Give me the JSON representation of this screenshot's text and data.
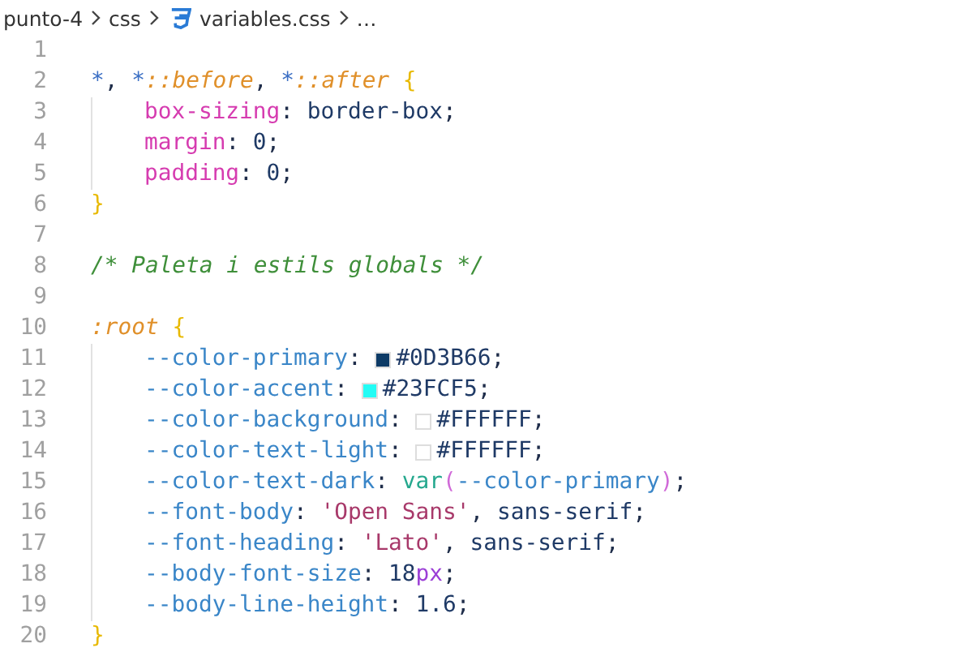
{
  "breadcrumb": [
    {
      "kind": "folder",
      "label": "punto-4"
    },
    {
      "kind": "folder",
      "label": "css"
    },
    {
      "kind": "file",
      "label": "variables.css"
    },
    {
      "kind": "more",
      "label": "…"
    }
  ],
  "editor": {
    "lines": [
      {
        "number": "1",
        "indented": false
      },
      {
        "number": "2",
        "indented": false,
        "tokens": [
          {
            "kind": "selector",
            "text": "*"
          },
          {
            "kind": "punct",
            "text": ", "
          },
          {
            "kind": "selector",
            "text": "*"
          },
          {
            "kind": "pseudo",
            "text": "::before"
          },
          {
            "kind": "punct",
            "text": ", "
          },
          {
            "kind": "selector",
            "text": "*"
          },
          {
            "kind": "pseudo",
            "text": "::after"
          },
          {
            "kind": "brace",
            "text": "{"
          }
        ]
      },
      {
        "number": "3",
        "indented": true,
        "tokens": [
          {
            "kind": "property",
            "text": "box-sizing"
          },
          {
            "kind": "punct",
            "text": ": "
          },
          {
            "kind": "value",
            "text": "border-box"
          },
          {
            "kind": "punct",
            "text": ";"
          }
        ]
      },
      {
        "number": "4",
        "indented": true,
        "tokens": [
          {
            "kind": "property",
            "text": "margin"
          },
          {
            "kind": "punct",
            "text": ": "
          },
          {
            "kind": "number",
            "text": "0"
          },
          {
            "kind": "punct",
            "text": ";"
          }
        ]
      },
      {
        "number": "5",
        "indented": true,
        "tokens": [
          {
            "kind": "property",
            "text": "padding"
          },
          {
            "kind": "punct",
            "text": ": "
          },
          {
            "kind": "number",
            "text": "0"
          },
          {
            "kind": "punct",
            "text": ";"
          }
        ]
      },
      {
        "number": "6",
        "indented": false,
        "tokens": [
          {
            "kind": "brace",
            "text": "}"
          }
        ]
      },
      {
        "number": "7",
        "indented": false
      },
      {
        "number": "8",
        "indented": false,
        "tokens": [
          {
            "kind": "comment",
            "text": "/* Paleta i estils globals */"
          }
        ]
      },
      {
        "number": "9",
        "indented": false
      },
      {
        "number": "10",
        "indented": false,
        "tokens": [
          {
            "kind": "pseudo",
            "text": ":root"
          },
          {
            "kind": "brace",
            "text": "{"
          }
        ]
      },
      {
        "number": "11",
        "indented": true,
        "tokens": [
          {
            "kind": "variable",
            "text": "--color-primary"
          },
          {
            "kind": "punct",
            "text": ": "
          },
          {
            "kind": "swatch",
            "color": "#0d3b66"
          },
          {
            "kind": "value",
            "text": "#0D3B66"
          },
          {
            "kind": "punct",
            "text": ";"
          }
        ]
      },
      {
        "number": "12",
        "indented": true,
        "tokens": [
          {
            "kind": "variable",
            "text": "--color-accent"
          },
          {
            "kind": "punct",
            "text": ": "
          },
          {
            "kind": "swatch",
            "color": "#23fcf5"
          },
          {
            "kind": "value",
            "text": "#23FCF5"
          },
          {
            "kind": "punct",
            "text": ";"
          }
        ]
      },
      {
        "number": "13",
        "indented": true,
        "tokens": [
          {
            "kind": "variable",
            "text": "--color-background"
          },
          {
            "kind": "punct",
            "text": ": "
          },
          {
            "kind": "swatch",
            "color": "#ffffff"
          },
          {
            "kind": "value",
            "text": "#FFFFFF"
          },
          {
            "kind": "punct",
            "text": ";"
          }
        ]
      },
      {
        "number": "14",
        "indented": true,
        "tokens": [
          {
            "kind": "variable",
            "text": "--color-text-light"
          },
          {
            "kind": "punct",
            "text": ": "
          },
          {
            "kind": "swatch",
            "color": "#ffffff"
          },
          {
            "kind": "value",
            "text": "#FFFFFF"
          },
          {
            "kind": "punct",
            "text": ";"
          }
        ]
      },
      {
        "number": "15",
        "indented": true,
        "tokens": [
          {
            "kind": "variable",
            "text": "--color-text-dark"
          },
          {
            "kind": "punct",
            "text": ": "
          },
          {
            "kind": "function",
            "text": "var"
          },
          {
            "kind": "paren",
            "text": "("
          },
          {
            "kind": "variable",
            "text": "--color-primary"
          },
          {
            "kind": "paren",
            "text": ")"
          },
          {
            "kind": "punct",
            "text": ";"
          }
        ]
      },
      {
        "number": "16",
        "indented": true,
        "tokens": [
          {
            "kind": "variable",
            "text": "--font-body"
          },
          {
            "kind": "punct",
            "text": ": "
          },
          {
            "kind": "string",
            "text": "'Open Sans'"
          },
          {
            "kind": "punct",
            "text": ", "
          },
          {
            "kind": "value",
            "text": "sans-serif"
          },
          {
            "kind": "punct",
            "text": ";"
          }
        ]
      },
      {
        "number": "17",
        "indented": true,
        "tokens": [
          {
            "kind": "variable",
            "text": "--font-heading"
          },
          {
            "kind": "punct",
            "text": ": "
          },
          {
            "kind": "string",
            "text": "'Lato'"
          },
          {
            "kind": "punct",
            "text": ", "
          },
          {
            "kind": "value",
            "text": "sans-serif"
          },
          {
            "kind": "punct",
            "text": ";"
          }
        ]
      },
      {
        "number": "18",
        "indented": true,
        "tokens": [
          {
            "kind": "variable",
            "text": "--body-font-size"
          },
          {
            "kind": "punct",
            "text": ": "
          },
          {
            "kind": "number",
            "text": "18"
          },
          {
            "kind": "unit",
            "text": "px"
          },
          {
            "kind": "punct",
            "text": ";"
          }
        ]
      },
      {
        "number": "19",
        "indented": true,
        "tokens": [
          {
            "kind": "variable",
            "text": "--body-line-height"
          },
          {
            "kind": "punct",
            "text": ": "
          },
          {
            "kind": "number",
            "text": "1.6"
          },
          {
            "kind": "punct",
            "text": ";"
          }
        ]
      },
      {
        "number": "20",
        "indented": false,
        "tokens": [
          {
            "kind": "brace",
            "text": "}"
          }
        ]
      }
    ]
  }
}
